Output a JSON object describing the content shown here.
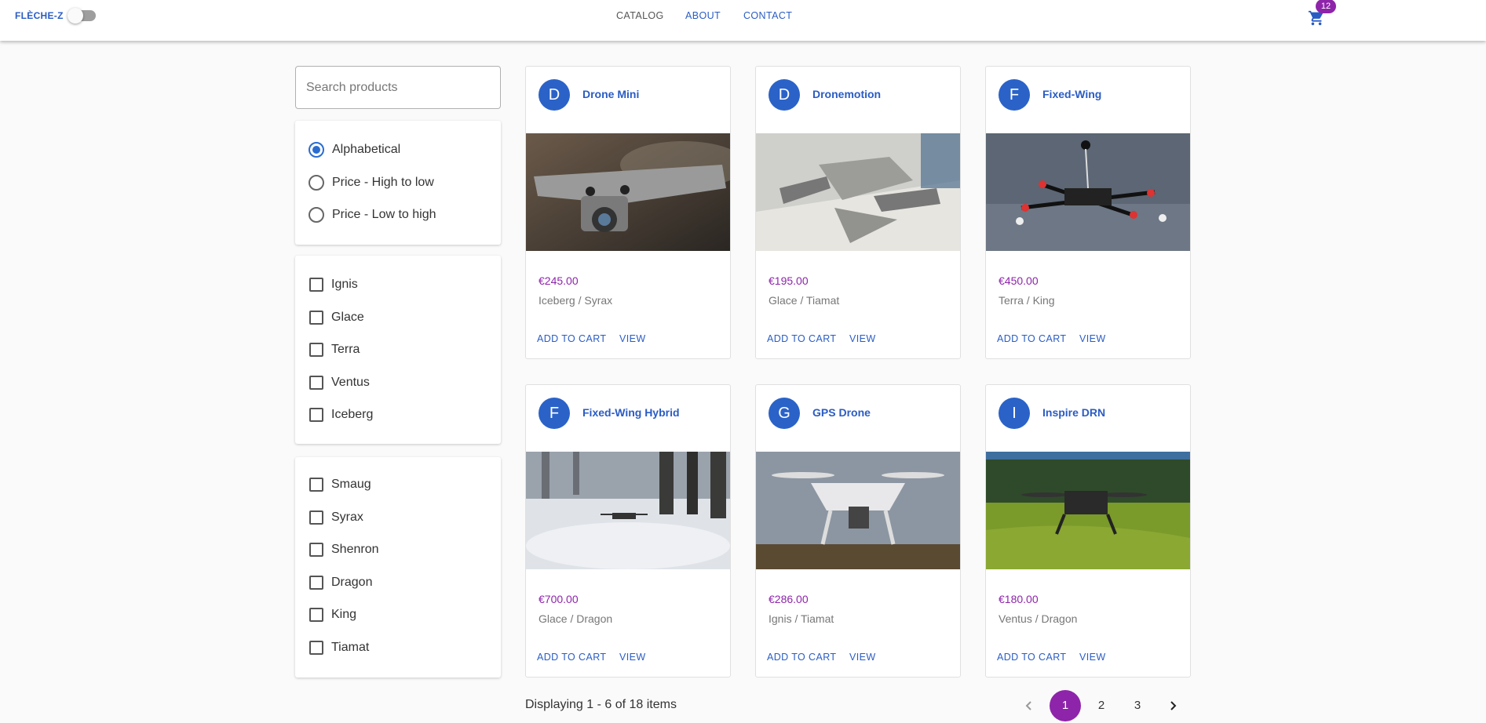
{
  "header": {
    "brand": "FLÈCHE-Z",
    "nav": [
      "CATALOG",
      "ABOUT",
      "CONTACT"
    ],
    "cart_count": "12"
  },
  "search": {
    "placeholder": "Search products",
    "value": ""
  },
  "sort": {
    "options": [
      "Alphabetical",
      "Price - High to low",
      "Price - Low to high"
    ],
    "selected": "Alphabetical"
  },
  "filters": {
    "elements": [
      "Ignis",
      "Glace",
      "Terra",
      "Ventus",
      "Iceberg"
    ],
    "dragons": [
      "Smaug",
      "Syrax",
      "Shenron",
      "Dragon",
      "King",
      "Tiamat"
    ]
  },
  "products": [
    {
      "initial": "D",
      "title": "Drone Mini",
      "price": "€245.00",
      "sub": "Iceberg / Syrax",
      "image": "drone-mini-photo"
    },
    {
      "initial": "D",
      "title": "Dronemotion",
      "price": "€195.00",
      "sub": "Glace / Tiamat",
      "image": "dronemotion-photo"
    },
    {
      "initial": "F",
      "title": "Fixed-Wing",
      "price": "€450.00",
      "sub": "Terra / King",
      "image": "fixed-wing-photo"
    },
    {
      "initial": "F",
      "title": "Fixed-Wing Hybrid",
      "price": "€700.00",
      "sub": "Glace / Dragon",
      "image": "fixed-wing-hybrid-photo"
    },
    {
      "initial": "G",
      "title": "GPS Drone",
      "price": "€286.00",
      "sub": "Ignis / Tiamat",
      "image": "gps-drone-photo"
    },
    {
      "initial": "I",
      "title": "Inspire DRN",
      "price": "€180.00",
      "sub": "Ventus / Dragon",
      "image": "inspire-drn-photo"
    }
  ],
  "card_actions": {
    "add": "ADD TO CART",
    "view": "VIEW"
  },
  "pagination": {
    "summary": "Displaying 1 - 6 of 18 items",
    "pages": [
      "1",
      "2",
      "3"
    ],
    "current": "1"
  },
  "colors": {
    "primary": "#2a5cc4",
    "accent": "#8e24aa"
  }
}
